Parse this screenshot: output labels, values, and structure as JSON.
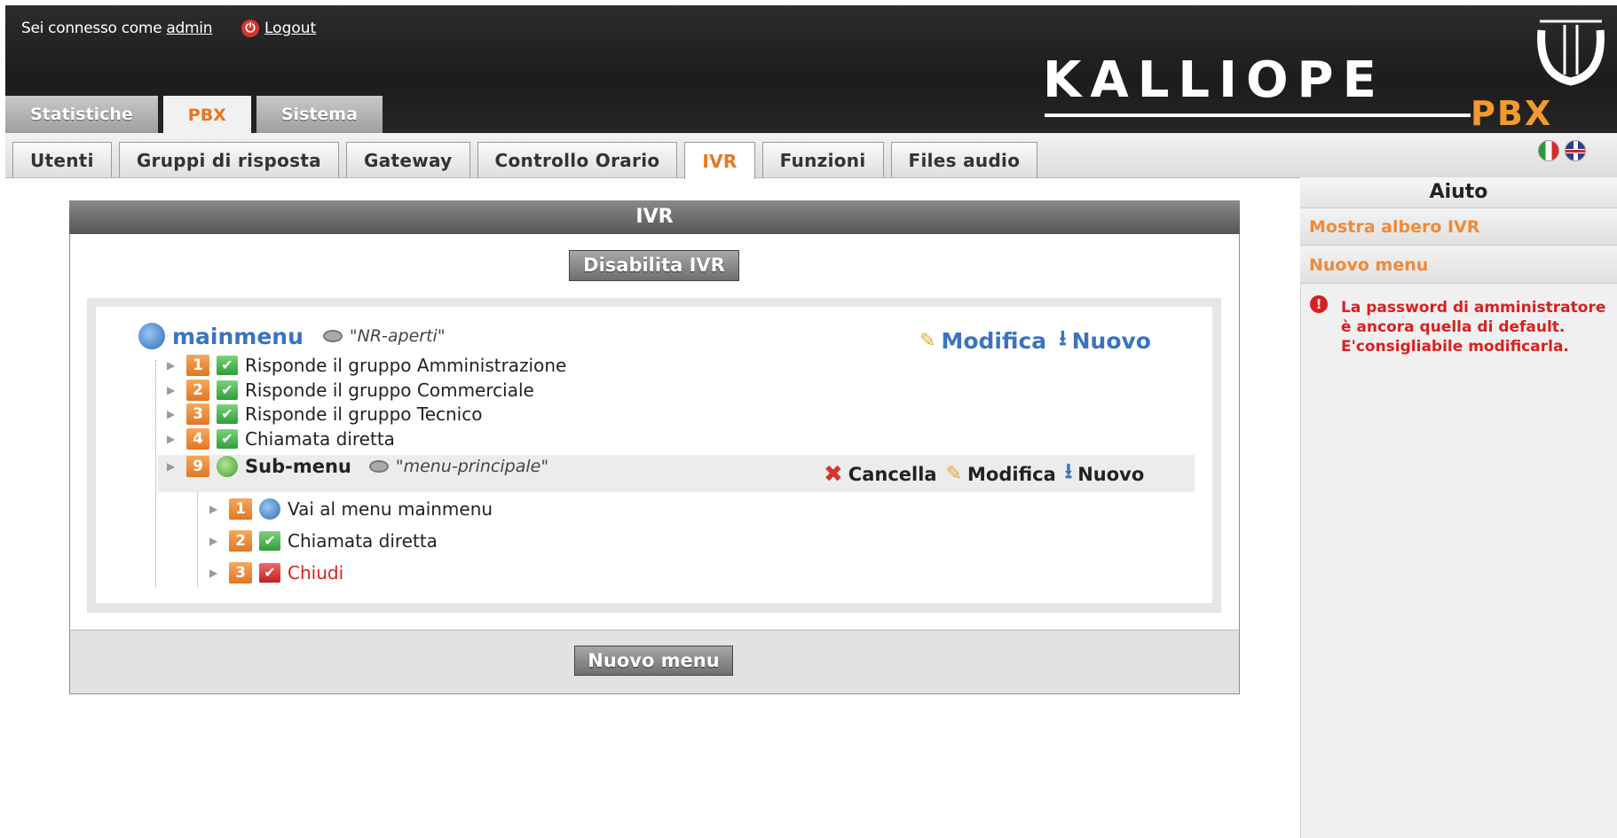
{
  "header": {
    "login_prefix": "Sei connesso come ",
    "user": "admin",
    "logout": "Logout",
    "logo_text": "KALLIOPE",
    "logo_pbx": "PBX"
  },
  "main_tabs": [
    {
      "label": "Statistiche"
    },
    {
      "label": "PBX"
    },
    {
      "label": "Sistema"
    }
  ],
  "sub_tabs": [
    {
      "label": "Utenti"
    },
    {
      "label": "Gruppi di risposta"
    },
    {
      "label": "Gateway"
    },
    {
      "label": "Controllo Orario"
    },
    {
      "label": "IVR"
    },
    {
      "label": "Funzioni"
    },
    {
      "label": "Files audio"
    }
  ],
  "panel": {
    "title": "IVR",
    "disable_button": "Disabilita IVR",
    "new_menu_button": "Nuovo menu"
  },
  "tree": {
    "root": {
      "name": "mainmenu",
      "audio": "\"NR-aperti\"",
      "edit": "Modifica",
      "new": "Nuovo"
    },
    "items": [
      {
        "key": "1",
        "label": "Risponde il gruppo Amministrazione"
      },
      {
        "key": "2",
        "label": "Risponde il gruppo Commerciale"
      },
      {
        "key": "3",
        "label": "Risponde il gruppo Tecnico"
      },
      {
        "key": "4",
        "label": "Chiamata diretta"
      }
    ],
    "submenu": {
      "key": "9",
      "name": "Sub-menu",
      "audio": "\"menu-principale\"",
      "delete": "Cancella",
      "edit": "Modifica",
      "new": "Nuovo"
    },
    "sub_items": [
      {
        "key": "1",
        "label": "Vai al menu mainmenu"
      },
      {
        "key": "2",
        "label": "Chiamata diretta"
      },
      {
        "key": "3",
        "label": "Chiudi"
      }
    ]
  },
  "sidebar": {
    "title": "Aiuto",
    "links": [
      {
        "label": "Mostra albero IVR"
      },
      {
        "label": "Nuovo menu"
      }
    ],
    "warning": "La password di amministratore è ancora quella di default. E'consigliabile modificarla."
  },
  "colors": {
    "accent": "#e87722",
    "link_blue": "#3a74c0",
    "warning": "#d9201f"
  }
}
